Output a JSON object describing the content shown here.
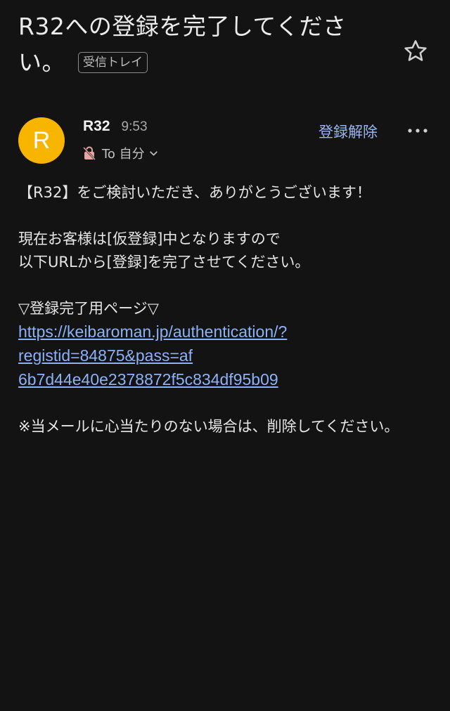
{
  "email": {
    "subject_line1": "R32への登録を完了してくださ",
    "subject_line2": "い。",
    "label": "受信トレイ",
    "sender": {
      "avatar_letter": "R",
      "avatar_color": "#f7b500",
      "name": "R32",
      "time": "9:53",
      "recipient": "To 自分"
    },
    "actions": {
      "unsubscribe": "登録解除",
      "star_icon": "star-outline-icon",
      "more_icon": "more-horizontal-icon"
    },
    "body": {
      "p1": "【R32】をご検討いただき、ありがとうございます！",
      "p2_line1": "現在お客様は[仮登録]中となりますので",
      "p2_line2": "以下URLから[登録]を完了させてください。",
      "p3_heading": "▽登録完了用ページ▽",
      "link_line1": "https://keibaroman.jp/authentication/?",
      "link_line2": "registid=84875&pass=af",
      "link_line3": "6b7d44e40e2378872f5c834df95b09",
      "p4": "※当メールに心当たりのない場合は、削除してください。"
    }
  },
  "colors": {
    "background": "#131313",
    "link": "#8cb1f5",
    "accent": "#9ab6f2"
  }
}
